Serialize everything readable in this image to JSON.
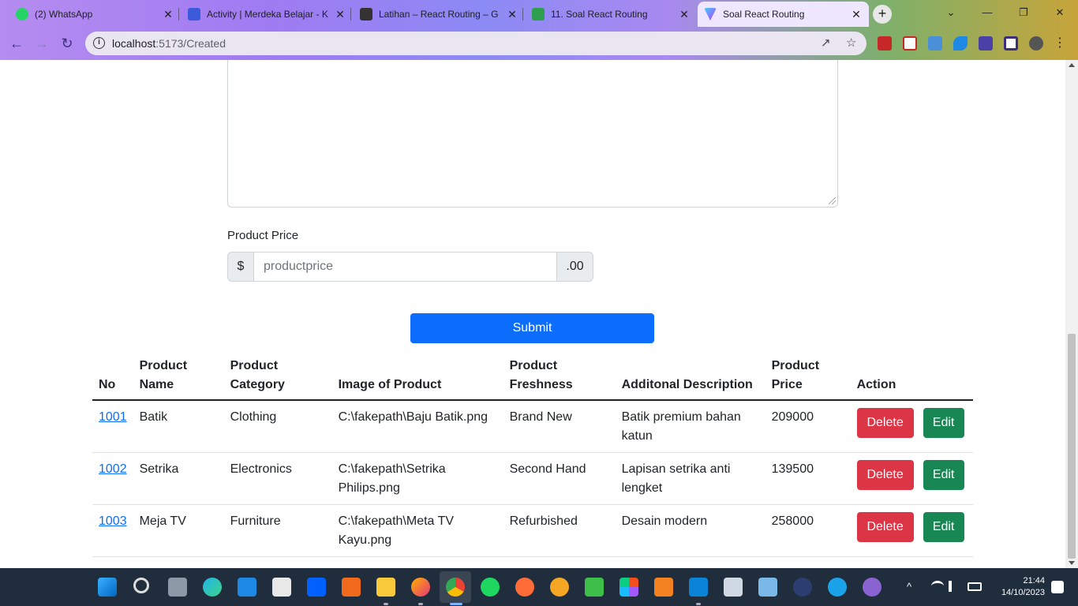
{
  "browser": {
    "tabs": [
      {
        "title": "(2) WhatsApp",
        "color": "#25d366"
      },
      {
        "title": "Activity | Merdeka Belajar - K",
        "color": "#3b5bdb"
      },
      {
        "title": "Latihan – React Routing – G",
        "color": "#333333"
      },
      {
        "title": "11. Soal React Routing",
        "color": "#2e9e4f"
      },
      {
        "title": "Soal React Routing",
        "color": "#a855f7"
      }
    ],
    "close_glyph": "✕",
    "new_tab": "+",
    "url_host": "localhost",
    "url_path": ":5173/Created",
    "info_glyph": "i",
    "window_controls": [
      "⌄",
      "—",
      "❐",
      "✕"
    ]
  },
  "form": {
    "price_label": "Product Price",
    "price_prefix": "$",
    "price_placeholder": "productprice",
    "price_suffix": ".00",
    "submit_label": "Submit"
  },
  "table": {
    "headers": {
      "no": "No",
      "name": "Product Name",
      "category": "Product Category",
      "image": "Image of Product",
      "freshness": "Product Freshness",
      "description": "Additonal Description",
      "price": "Product Price",
      "action": "Action"
    },
    "rows": [
      {
        "no": "1001",
        "name": "Batik",
        "category": "Clothing",
        "image": "C:\\fakepath\\Baju Batik.png",
        "freshness": "Brand New",
        "description": "Batik premium bahan katun",
        "price": "209000"
      },
      {
        "no": "1002",
        "name": "Setrika",
        "category": "Electronics",
        "image": "C:\\fakepath\\Setrika Philips.png",
        "freshness": "Second Hand",
        "description": "Lapisan setrika anti lengket",
        "price": "139500"
      },
      {
        "no": "1003",
        "name": "Meja TV",
        "category": "Furniture",
        "image": "C:\\fakepath\\Meta TV Kayu.png",
        "freshness": "Refurbished",
        "description": "Desain modern",
        "price": "258000"
      }
    ],
    "delete_label": "Delete",
    "edit_label": "Edit"
  },
  "taskbar": {
    "time": "21:44",
    "date": "14/10/2023",
    "tray_up": "^"
  }
}
